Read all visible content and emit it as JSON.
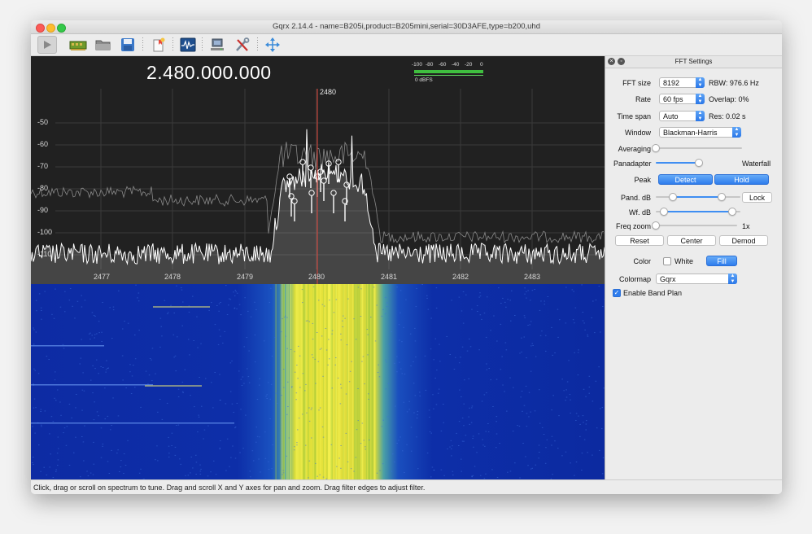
{
  "window": {
    "title": "Gqrx 2.14.4 - name=B205i,product=B205mini,serial=30D3AFE,type=b200,uhd"
  },
  "toolbar": {
    "icons": [
      "play-icon",
      "hardware-icon",
      "open-icon",
      "save-icon",
      "bookmark-icon",
      "waveform-icon",
      "network-icon",
      "tools-icon",
      "move-icon"
    ]
  },
  "spectrum": {
    "frequency": "2.480.000.000",
    "center_marker": "2480",
    "y_ticks": [
      "-50",
      "-60",
      "-70",
      "-80",
      "-90",
      "-100",
      "-110"
    ],
    "x_ticks": [
      "2477",
      "2478",
      "2479",
      "2480",
      "2481",
      "2482",
      "2483"
    ],
    "meter": {
      "ticks": [
        "-100",
        "-80",
        "-60",
        "-40",
        "-20",
        "0"
      ],
      "label": "0 dBFS"
    }
  },
  "panel": {
    "title": "FFT Settings",
    "fft_size": {
      "label": "FFT size",
      "value": "8192",
      "info": "RBW: 976.6 Hz"
    },
    "rate": {
      "label": "Rate",
      "value": "60 fps",
      "info": "Overlap: 0%"
    },
    "time_span": {
      "label": "Time span",
      "value": "Auto",
      "info": "Res: 0.02 s"
    },
    "window": {
      "label": "Window",
      "value": "Blackman-Harris"
    },
    "averaging": {
      "label": "Averaging",
      "level": 0.0
    },
    "pan_wf": {
      "left": "Panadapter",
      "right": "Waterfall",
      "level": 0.5
    },
    "peak": {
      "label": "Peak",
      "detect": "Detect",
      "hold": "Hold"
    },
    "pand_db": {
      "label": "Pand. dB",
      "lock": "Lock",
      "low": 0.2,
      "high": 0.78
    },
    "wf_db": {
      "label": "Wf. dB",
      "low": 0.1,
      "high": 0.9
    },
    "freq_zoom": {
      "label": "Freq zoom",
      "value": "1x",
      "level": 0.0
    },
    "buttons": {
      "reset": "Reset",
      "center": "Center",
      "demod": "Demod"
    },
    "color": {
      "label": "Color",
      "white": "White",
      "fill": "Fill"
    },
    "colormap": {
      "label": "Colormap",
      "value": "Gqrx"
    },
    "band_plan": {
      "label": "Enable Band Plan"
    }
  },
  "status": "Click, drag or scroll on spectrum to tune. Drag and scroll X and Y axes for pan and zoom. Drag filter edges to adjust filter."
}
